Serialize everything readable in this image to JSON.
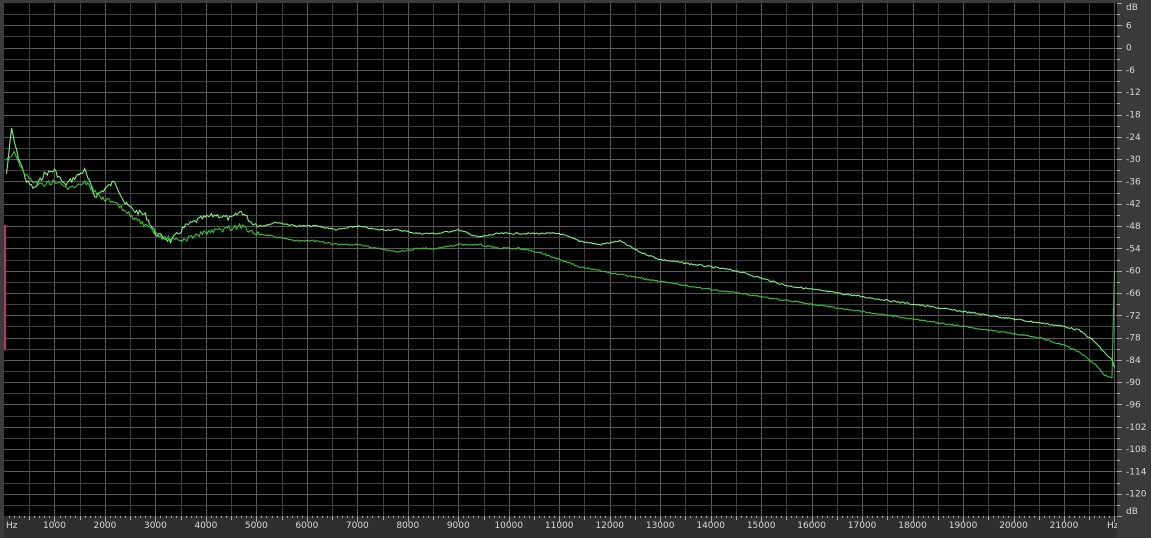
{
  "chart_data": {
    "type": "line",
    "x_unit_label": "Hz",
    "y_unit_label": "dB",
    "xlim": [
      0,
      22050
    ],
    "ylim": [
      -126,
      12
    ],
    "x_ticks": [
      1000,
      2000,
      3000,
      4000,
      5000,
      6000,
      7000,
      8000,
      9000,
      10000,
      11000,
      12000,
      13000,
      14000,
      15000,
      16000,
      17000,
      18000,
      19000,
      20000,
      21000
    ],
    "y_ticks": [
      6,
      0,
      -6,
      -12,
      -18,
      -24,
      -30,
      -36,
      -42,
      -48,
      -54,
      -60,
      -66,
      -72,
      -78,
      -84,
      -90,
      -96,
      -102,
      -108,
      -114,
      -120
    ],
    "grid": true,
    "colors": {
      "background": "#000000",
      "grid": "#555555",
      "series_bright": "#8aff8a",
      "series_dark": "#3fcf3f",
      "marker": "#c0306a"
    },
    "series": [
      {
        "color": "#8aff8a",
        "x": [
          50,
          150,
          250,
          350,
          450,
          600,
          800,
          1000,
          1200,
          1400,
          1600,
          1800,
          2000,
          2200,
          2400,
          2600,
          2800,
          3000,
          3300,
          3600,
          3900,
          4200,
          4500,
          4700,
          4900,
          5100,
          5400,
          5800,
          6200,
          6600,
          7000,
          7400,
          7800,
          8200,
          8600,
          9000,
          9400,
          9800,
          10200,
          10600,
          11000,
          11400,
          11800,
          12200,
          12600,
          13000,
          13500,
          14000,
          14500,
          15000,
          15500,
          16000,
          16500,
          17000,
          17500,
          18000,
          18500,
          19000,
          19500,
          20000,
          20500,
          21000,
          21300,
          21600,
          21800,
          21950,
          22000
        ],
        "y": [
          -34,
          -22,
          -28,
          -32,
          -36,
          -38,
          -34,
          -33,
          -37,
          -35,
          -33,
          -40,
          -38,
          -36,
          -42,
          -44,
          -45,
          -50,
          -52,
          -48,
          -46,
          -45,
          -46,
          -44,
          -47,
          -48,
          -47,
          -48,
          -48,
          -49,
          -48,
          -49,
          -49,
          -50,
          -50,
          -49,
          -51,
          -50,
          -50,
          -50,
          -50,
          -52,
          -53,
          -52,
          -55,
          -57,
          -58,
          -59,
          -60,
          -62,
          -64,
          -65,
          -66,
          -67,
          -68,
          -69,
          -70,
          -71,
          -72,
          -73,
          -74,
          -75,
          -76,
          -79,
          -82,
          -84,
          -86
        ]
      },
      {
        "color": "#3fcf3f",
        "x": [
          50,
          200,
          400,
          700,
          1000,
          1300,
          1600,
          1900,
          2200,
          2500,
          2800,
          3100,
          3500,
          3900,
          4300,
          4700,
          5000,
          5400,
          5800,
          6200,
          6600,
          7000,
          7400,
          7800,
          8200,
          8600,
          9000,
          9400,
          9800,
          10200,
          10600,
          11000,
          11400,
          11800,
          12200,
          12600,
          13000,
          13500,
          14000,
          14500,
          15000,
          15500,
          16000,
          16500,
          17000,
          17500,
          18000,
          18500,
          19000,
          19500,
          20000,
          20500,
          21000,
          21300,
          21600,
          21800,
          21950,
          22000
        ],
        "y": [
          -30,
          -28,
          -34,
          -37,
          -36,
          -38,
          -36,
          -40,
          -42,
          -45,
          -48,
          -51,
          -52,
          -50,
          -49,
          -48,
          -50,
          -51,
          -52,
          -52,
          -53,
          -53,
          -54,
          -55,
          -54,
          -54,
          -53,
          -53,
          -54,
          -54,
          -55,
          -57,
          -59,
          -60,
          -61,
          -62,
          -63,
          -64,
          -65,
          -66,
          -67,
          -68,
          -69,
          -70,
          -71,
          -72,
          -73,
          -74,
          -75,
          -76,
          -77,
          -78,
          -80,
          -82,
          -85,
          -88,
          -89,
          -60
        ]
      }
    ]
  }
}
